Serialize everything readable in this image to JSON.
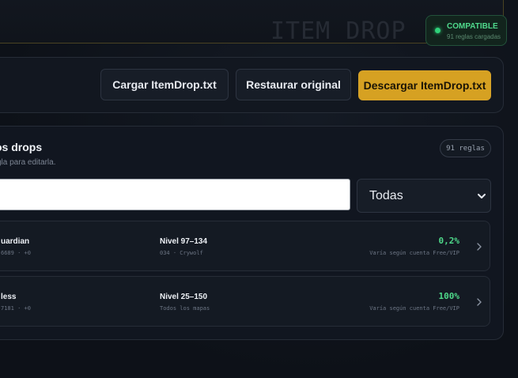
{
  "header": {
    "title": "ITEM DROP",
    "compat": {
      "title": "COMPATIBLE",
      "subtitle": "91 reglas cargadas",
      "dot_color": "#2fd27a"
    }
  },
  "actions": {
    "load_label": "Cargar ItemDrop.txt",
    "restore_label": "Restaurar original",
    "download_label": "Descargar ItemDrop.txt",
    "accent_color": "#d6a122"
  },
  "rules": {
    "title": "os drops",
    "subtitle": "gla para editarla.",
    "count": "91 reglas",
    "search": {
      "value": "",
      "placeholder": ""
    },
    "filter": {
      "selected": "Todas"
    },
    "items": [
      {
        "name": "uardian",
        "meta": "6689 · +0",
        "level": "Nivel 97–134",
        "map": "034 · Crywolf",
        "rate": "0,2%",
        "note": "Varía según cuenta Free/VIP"
      },
      {
        "name": "less",
        "meta": "7181 · +0",
        "level": "Nivel 25–150",
        "map": "Todos los mapas",
        "rate": "100%",
        "note": "Varía según cuenta Free/VIP"
      }
    ]
  }
}
